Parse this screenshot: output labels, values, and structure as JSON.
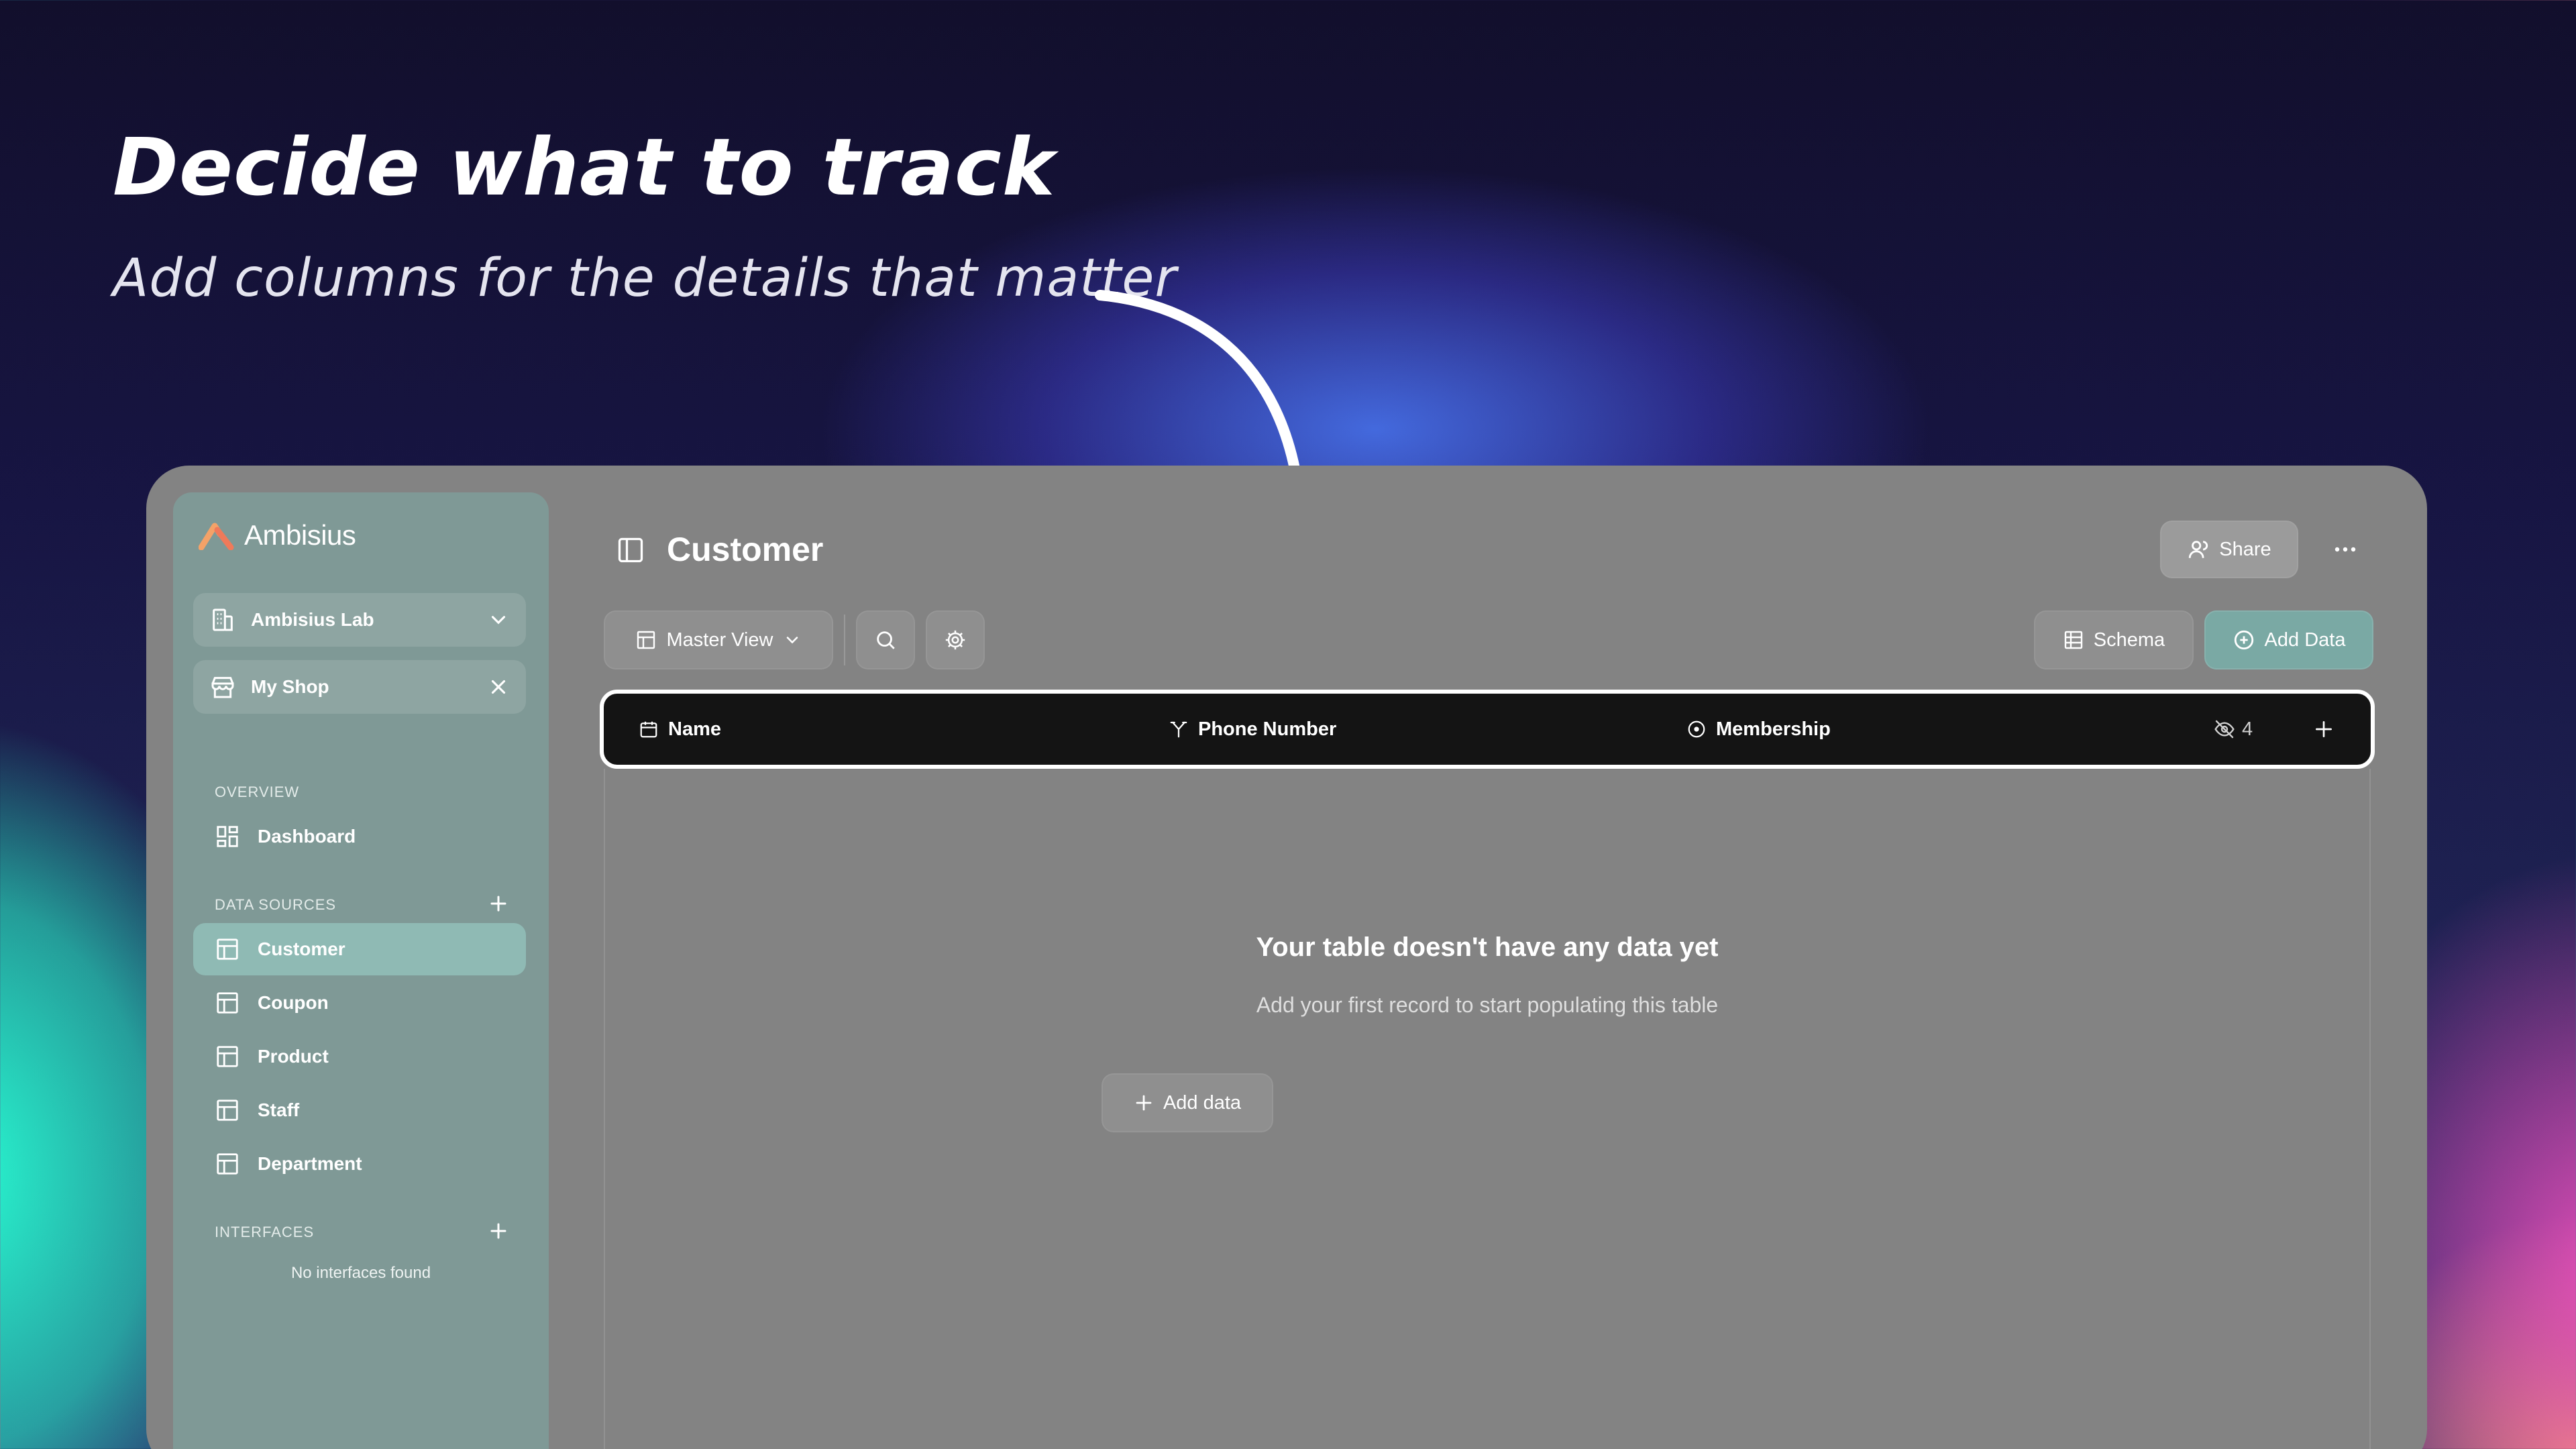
{
  "hero": {
    "title": "Decide what to track",
    "subtitle": "Add columns for the details that matter"
  },
  "sidebar": {
    "brand": "Ambisius",
    "workspace": "Ambisius Lab",
    "shop": "My Shop",
    "overview_label": "OVERVIEW",
    "overview_items": [
      {
        "label": "Dashboard",
        "icon": "dashboard-icon"
      }
    ],
    "data_sources_label": "DATA SOURCES",
    "data_sources": [
      {
        "label": "Customer",
        "icon": "table-icon",
        "active": true
      },
      {
        "label": "Coupon",
        "icon": "table-icon"
      },
      {
        "label": "Product",
        "icon": "table-icon"
      },
      {
        "label": "Staff",
        "icon": "table-icon"
      },
      {
        "label": "Department",
        "icon": "table-icon"
      }
    ],
    "interfaces_label": "INTERFACES",
    "interfaces_empty": "No interfaces found"
  },
  "header": {
    "title": "Customer",
    "share_label": "Share"
  },
  "toolbar": {
    "view_label": "Master View",
    "schema_label": "Schema",
    "add_data_label": "Add Data"
  },
  "table": {
    "columns": [
      {
        "label": "Name",
        "icon": "calendar-icon"
      },
      {
        "label": "Phone Number",
        "icon": "branch-icon"
      },
      {
        "label": "Membership",
        "icon": "circle-dot-icon"
      }
    ],
    "hidden_count": "4",
    "empty_title": "Your table doesn't have any data yet",
    "empty_subtitle": "Add your first record to start populating this table",
    "add_data_label": "Add data"
  },
  "colors": {
    "accent": "#7aa9a4",
    "active_nav": "#8fbab4",
    "sidebar": "#7f9996",
    "app_bg": "#838383",
    "header_row": "#141414"
  }
}
